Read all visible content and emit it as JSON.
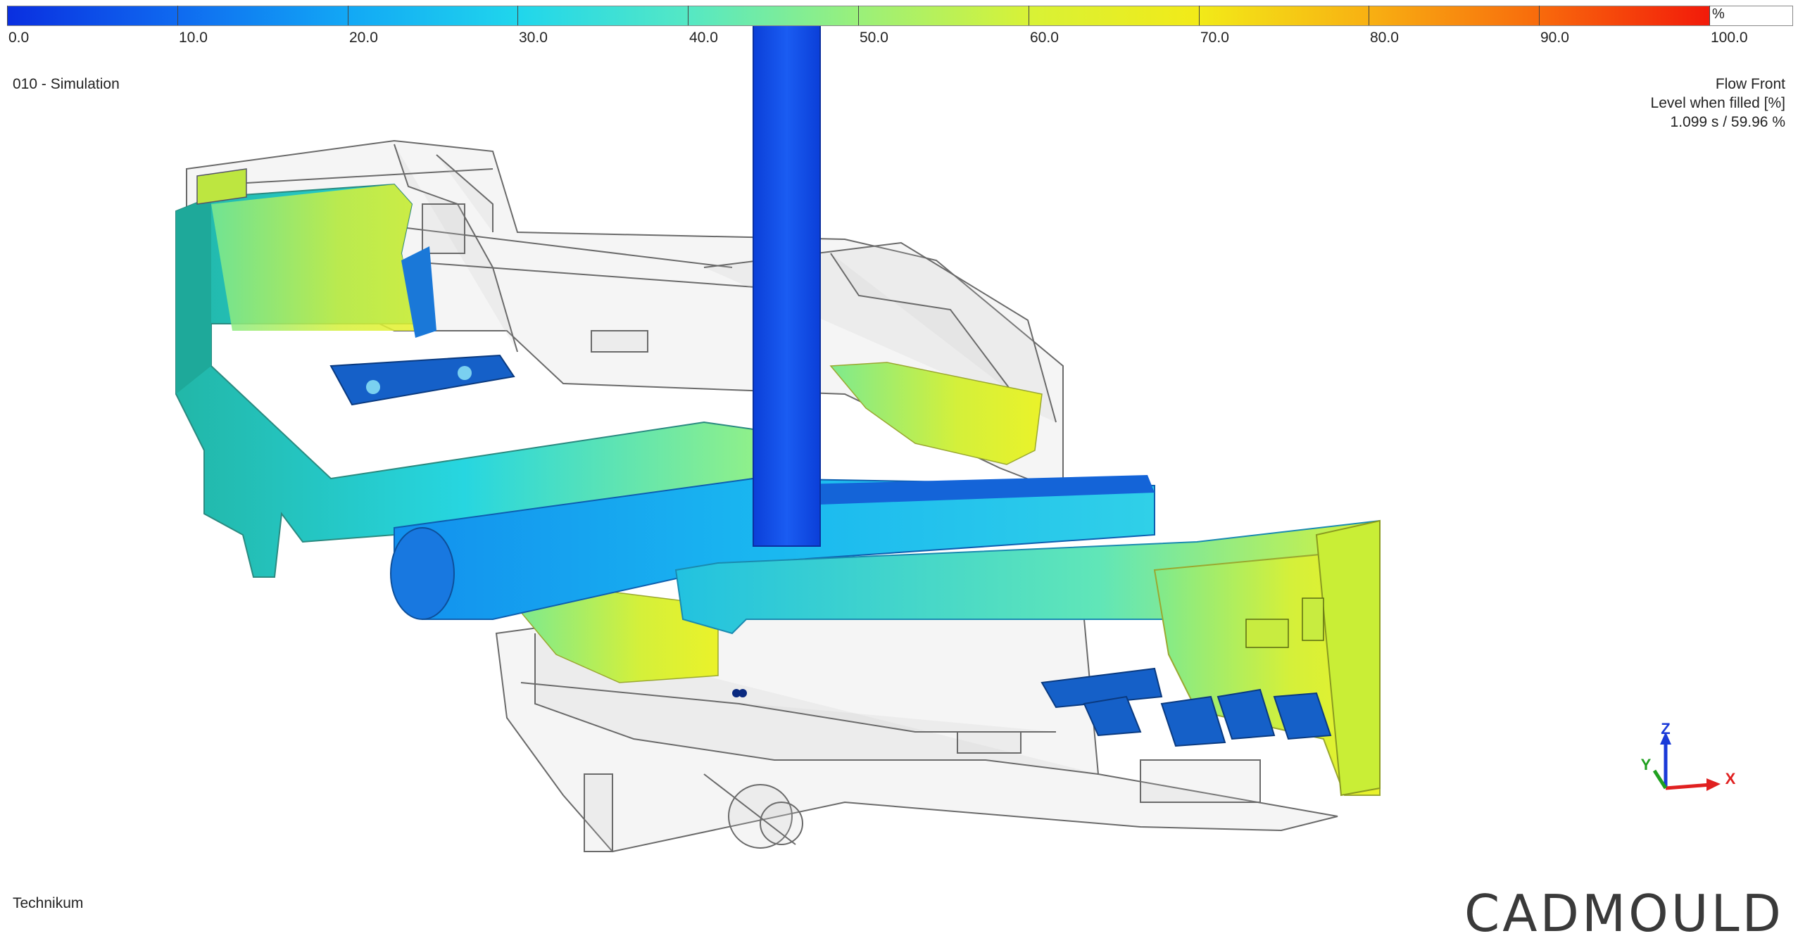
{
  "legend": {
    "unit": "%",
    "labels": [
      "0.0",
      "10.0",
      "20.0",
      "30.0",
      "40.0",
      "50.0",
      "60.0",
      "70.0",
      "80.0",
      "90.0",
      "100.0"
    ]
  },
  "simulation_title": "010 - Simulation",
  "result": {
    "name": "Flow Front",
    "quantity": "Level when filled [%]",
    "time_value": "1.099 s  /  59.96 %"
  },
  "footer": {
    "label": "Technikum"
  },
  "brand": "CADMOULD",
  "axes": {
    "z": "Z",
    "y": "Y",
    "x": "X"
  },
  "colors": {
    "scale_low": "#0a2fe0",
    "scale_mid": "#9af07a",
    "scale_high": "#f21a0a",
    "brand_text": "#3a3a3a"
  }
}
